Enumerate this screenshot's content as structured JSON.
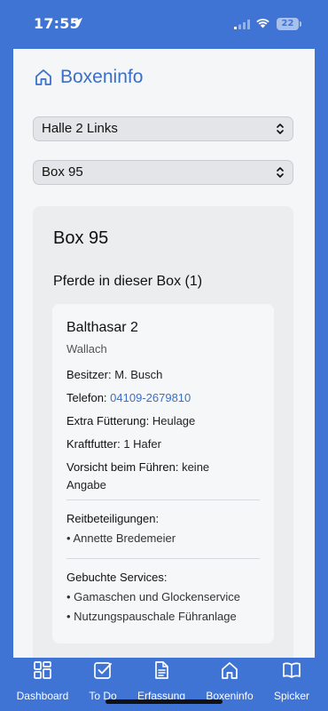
{
  "status_bar": {
    "time": "17:55",
    "battery": "22"
  },
  "header": {
    "title": "Boxeninfo"
  },
  "selects": {
    "hall": "Halle 2 Links",
    "box": "Box 95"
  },
  "box": {
    "title": "Box 95",
    "horses_heading": "Pferde in dieser Box (1)",
    "horse": {
      "name": "Balthasar 2",
      "type": "Wallach",
      "owner_label": "Besitzer:",
      "owner": "M. Busch",
      "phone_label": "Telefon:",
      "phone": "04109-2679810",
      "extra_feed_label": "Extra Fütterung:",
      "extra_feed": "Heulage",
      "concentrate_label": "Kraftfutter:",
      "concentrate": "1 Hafer",
      "caution_label": "Vorsicht beim Führen:",
      "caution_line1": "keine",
      "caution_line2": "Angabe",
      "riding_shares_label": "Reitbeteiligungen:",
      "riding_shares": [
        "• Annette Bredemeier"
      ],
      "services_label": "Gebuchte Services:",
      "services": [
        "• Gamaschen und Glockenservice",
        "• Nutzungspauschale Führanlage"
      ]
    }
  },
  "tabbar": {
    "items": [
      {
        "label": "Dashboard",
        "icon": "dashboard-icon"
      },
      {
        "label": "To Do",
        "icon": "checkbox-icon"
      },
      {
        "label": "Erfassung",
        "icon": "document-icon"
      },
      {
        "label": "Boxeninfo",
        "icon": "home-icon"
      },
      {
        "label": "Spicker",
        "icon": "book-icon"
      }
    ]
  },
  "colors": {
    "primary": "#3f74d4",
    "link": "#3a6fc9",
    "page_bg": "#f5f6f7",
    "card_bg": "#ebedef"
  }
}
